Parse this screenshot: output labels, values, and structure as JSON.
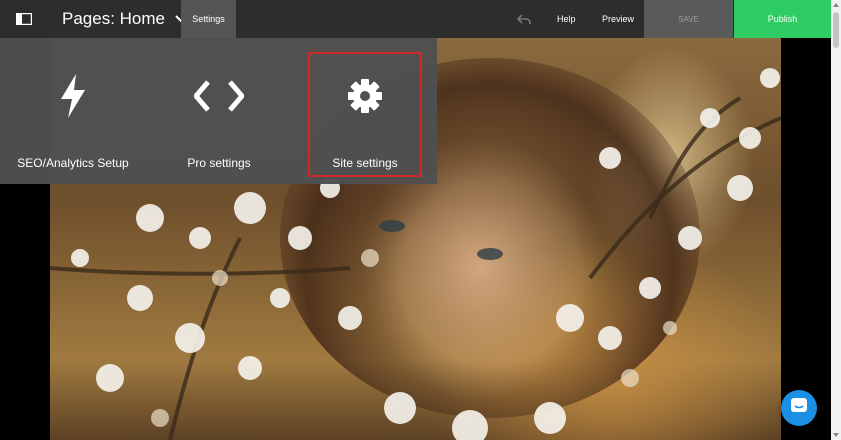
{
  "topbar": {
    "page_selector_label": "Pages: Home",
    "settings_tab": "Settings",
    "help": "Help",
    "preview": "Preview",
    "save": "SAVE",
    "publish": "Publish"
  },
  "settings_menu": {
    "items": [
      {
        "label": "SEO/Analytics Setup",
        "icon": "lightning-icon"
      },
      {
        "label": "Pro settings",
        "icon": "code-icon"
      },
      {
        "label": "Site settings",
        "icon": "gear-icon",
        "highlighted": true
      }
    ]
  },
  "colors": {
    "topbar": "#2d2d2d",
    "settings_tab_active": "#555555",
    "save_disabled": "#5a5a5a",
    "publish": "#2ecc63",
    "dropdown": "#505050",
    "highlight_border": "#d0272a",
    "chat": "#1a8fe3"
  }
}
